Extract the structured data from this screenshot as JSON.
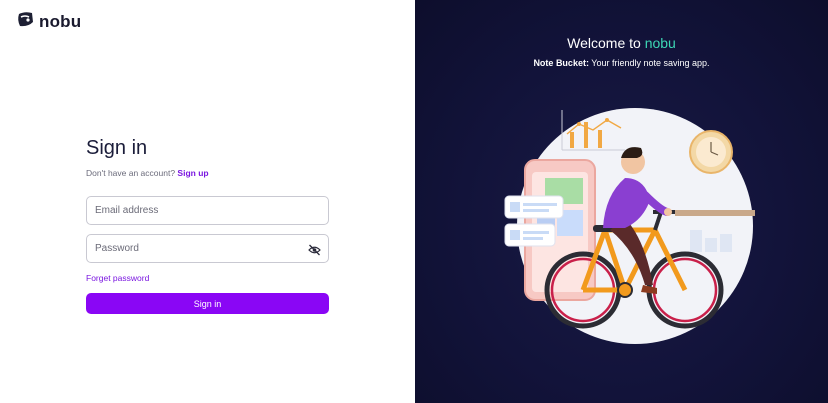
{
  "brand": {
    "name": "nobu",
    "logo_icon": "nobu-logo-icon"
  },
  "form": {
    "title": "Sign in",
    "no_account_text": "Don't have an account?",
    "signup_link": "Sign up",
    "email_placeholder": "Email address",
    "password_placeholder": "Password",
    "password_toggle_icon": "eye-off-icon",
    "forgot_link": "Forget password",
    "submit_label": "Sign in"
  },
  "hero": {
    "welcome_prefix": "Welcome to",
    "welcome_brand": "nobu",
    "tagline_bold": "Note Bucket:",
    "tagline_rest": "Your friendly note saving app."
  },
  "colors": {
    "accent": "#8a06f5",
    "brand_highlight": "#3dd7b5",
    "panel_bg": "#12133a"
  }
}
